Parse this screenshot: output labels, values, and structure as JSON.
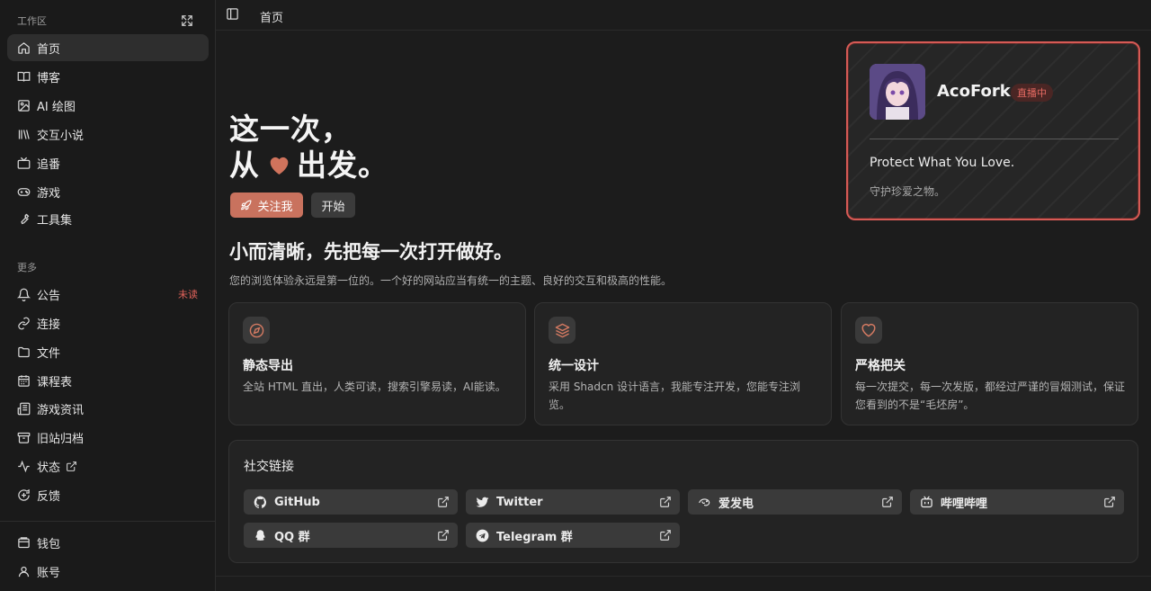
{
  "sidebar": {
    "workspace_label": "工作区",
    "more_label": "更多",
    "workspace_items": [
      {
        "label": "首页",
        "icon": "home-icon"
      },
      {
        "label": "博客",
        "icon": "book-open-icon"
      },
      {
        "label": "AI 绘图",
        "icon": "image-icon"
      },
      {
        "label": "交互小说",
        "icon": "library-icon"
      },
      {
        "label": "追番",
        "icon": "tv-icon"
      },
      {
        "label": "游戏",
        "icon": "gamepad-icon"
      },
      {
        "label": "工具集",
        "icon": "wrench-icon"
      }
    ],
    "more_items": [
      {
        "label": "公告",
        "icon": "bell-icon",
        "badge": "未读"
      },
      {
        "label": "连接",
        "icon": "link-icon"
      },
      {
        "label": "文件",
        "icon": "folder-icon"
      },
      {
        "label": "课程表",
        "icon": "calendar-icon"
      },
      {
        "label": "游戏资讯",
        "icon": "newspaper-icon"
      },
      {
        "label": "旧站归档",
        "icon": "archive-icon"
      },
      {
        "label": "状态",
        "icon": "activity-icon"
      },
      {
        "label": "反馈",
        "icon": "message-plus-icon"
      }
    ],
    "bottom_items": [
      {
        "label": "钱包",
        "icon": "wallet-icon"
      },
      {
        "label": "账号",
        "icon": "user-icon"
      }
    ]
  },
  "topbar": {
    "breadcrumb": "首页"
  },
  "hero": {
    "line1": "这一次，",
    "line2_before": "从",
    "line2_after": "出发。",
    "follow_label": "关注我",
    "start_label": "开始"
  },
  "profile": {
    "name": "AcoFork",
    "live_badge": "直播中",
    "motto": "Protect What You Love.",
    "motto_cn": "守护珍爱之物。"
  },
  "tagline": {
    "title": "小而清晰，先把每一次打开做好。",
    "subtitle": "您的浏览体验永远是第一位的。一个好的网站应当有统一的主题、良好的交互和极高的性能。"
  },
  "features": [
    {
      "title": "静态导出",
      "desc": "全站 HTML 直出，人类可读，搜索引擎易读，AI能读。",
      "icon": "compass-icon"
    },
    {
      "title": "统一设计",
      "desc": "采用 Shadcn 设计语言，我能专注开发，您能专注浏览。",
      "icon": "layers-icon"
    },
    {
      "title": "严格把关",
      "desc": "每一次提交，每一次发版，都经过严谨的冒烟测试，保证您看到的不是“毛坯房”。",
      "icon": "heart-icon"
    }
  ],
  "social": {
    "title": "社交链接",
    "links": [
      {
        "label": "GitHub",
        "icon": "github-icon"
      },
      {
        "label": "Twitter",
        "icon": "twitter-icon"
      },
      {
        "label": "爱发电",
        "icon": "afdian-icon"
      },
      {
        "label": "哔哩哔哩",
        "icon": "bilibili-icon"
      },
      {
        "label": "QQ 群",
        "icon": "qq-icon"
      },
      {
        "label": "Telegram 群",
        "icon": "telegram-icon"
      }
    ]
  },
  "colors": {
    "accent": "#c9725e",
    "live_border": "#d65a55",
    "badge_red": "#e0625a"
  }
}
